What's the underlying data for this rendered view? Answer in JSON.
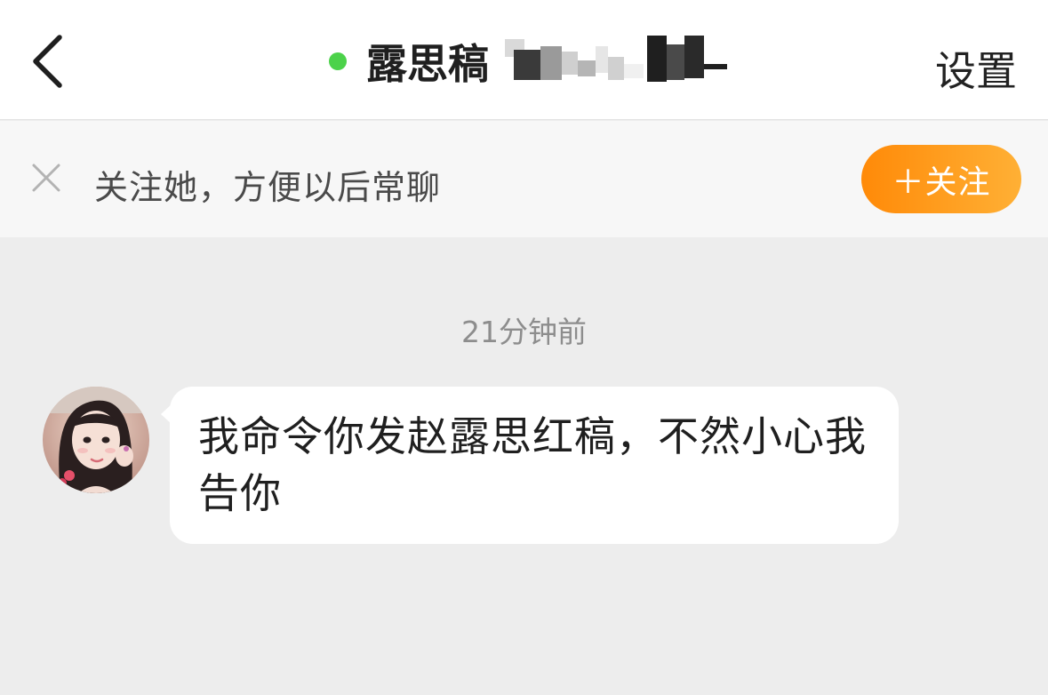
{
  "header": {
    "title": "露思稿",
    "settings_label": "设置",
    "online_color": "#4cd24a"
  },
  "follow_bar": {
    "prompt": "关注她，方便以后常聊",
    "follow_label": "＋关注",
    "accent": "#ff8a08"
  },
  "chat": {
    "timestamp": "21分钟前",
    "messages": [
      {
        "text": "我命令你发赵露思红稿，不然小心我告你"
      }
    ]
  },
  "icons": {
    "back": "chevron-left-icon",
    "close": "close-icon",
    "online": "online-dot-icon"
  }
}
